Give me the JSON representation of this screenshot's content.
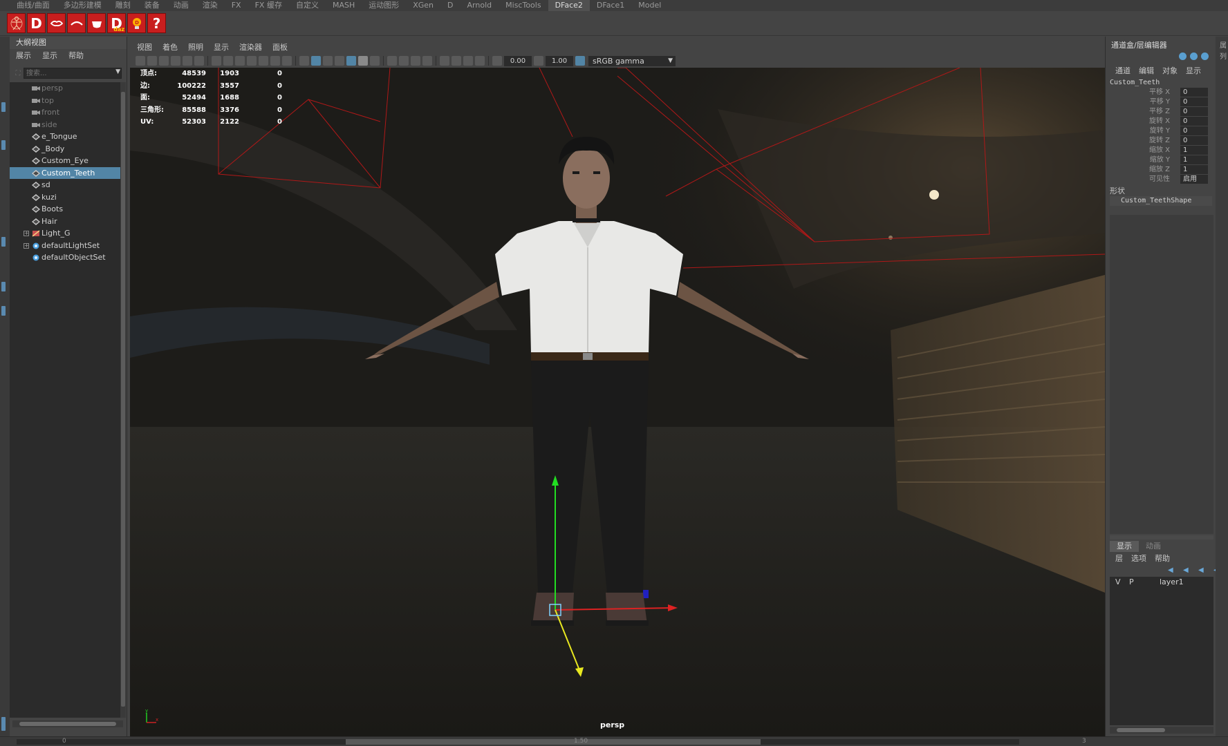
{
  "shelf_tabs": [
    "曲线/曲面",
    "多边形建模",
    "雕刻",
    "装备",
    "动画",
    "渲染",
    "FX",
    "FX 缓存",
    "自定义",
    "MASH",
    "运动图形",
    "XGen",
    "D",
    "Arnold",
    "MiscTools",
    "DFace2",
    "DFace1",
    "Model"
  ],
  "shelf_active": "DFace2",
  "shelf_icons": [
    "figure-icon",
    "d-icon",
    "lips-icon",
    "brow-icon",
    "mouth-icon",
    "daz-d-icon",
    "daz-bulb-icon",
    "help-icon"
  ],
  "shelf_icon_glyphs": {
    "d": "D",
    "daz_d": "D",
    "daz_mark": "daz",
    "help": "?"
  },
  "colors": {
    "accent": "#5285a6",
    "shelf_red": "#c81e1e",
    "panel": "#444444",
    "field": "#2b2b2b"
  },
  "outliner": {
    "title": "大纲视图",
    "menu": [
      "展示",
      "显示",
      "帮助"
    ],
    "search_placeholder": "搜索...",
    "items": [
      {
        "label": "persp",
        "type": "camera",
        "dim": true
      },
      {
        "label": "top",
        "type": "camera",
        "dim": true
      },
      {
        "label": "front",
        "type": "camera",
        "dim": true
      },
      {
        "label": "side",
        "type": "camera",
        "dim": true
      },
      {
        "label": "e_Tongue",
        "type": "mesh"
      },
      {
        "label": "_Body",
        "type": "mesh"
      },
      {
        "label": "Custom_Eye",
        "type": "mesh"
      },
      {
        "label": "Custom_Teeth",
        "type": "mesh",
        "selected": true
      },
      {
        "label": "sd",
        "type": "mesh"
      },
      {
        "label": "kuzi",
        "type": "mesh"
      },
      {
        "label": "Boots",
        "type": "mesh"
      },
      {
        "label": "Hair",
        "type": "mesh"
      },
      {
        "label": "Light_G",
        "type": "light",
        "expand": true
      },
      {
        "label": "defaultLightSet",
        "type": "set",
        "expand": true
      },
      {
        "label": "defaultObjectSet",
        "type": "set"
      }
    ]
  },
  "viewport": {
    "menu": [
      "视图",
      "着色",
      "照明",
      "显示",
      "渲染器",
      "面板"
    ],
    "exposure": "0.00",
    "gamma": "1.00",
    "colorspace": "sRGB gamma",
    "camera": "persp",
    "hud": [
      {
        "label": "顶点:",
        "v1": "48539",
        "v2": "1903",
        "v3": "0"
      },
      {
        "label": "边:",
        "v1": "100222",
        "v2": "3557",
        "v3": "0"
      },
      {
        "label": "面:",
        "v1": "52494",
        "v2": "1688",
        "v3": "0"
      },
      {
        "label": "三角形:",
        "v1": "85588",
        "v2": "3376",
        "v3": "0"
      },
      {
        "label": "UV:",
        "v1": "52303",
        "v2": "2122",
        "v3": "0"
      }
    ],
    "axis_labels": {
      "y": "y",
      "x": "x"
    }
  },
  "channel_box": {
    "title": "通道盒/层编辑器",
    "menu": [
      "通道",
      "编辑",
      "对象",
      "显示"
    ],
    "object": "Custom_Teeth",
    "attributes": [
      {
        "label": "平移 X",
        "value": "0"
      },
      {
        "label": "平移 Y",
        "value": "0"
      },
      {
        "label": "平移 Z",
        "value": "0"
      },
      {
        "label": "旋转 X",
        "value": "0"
      },
      {
        "label": "旋转 Y",
        "value": "0"
      },
      {
        "label": "旋转 Z",
        "value": "0"
      },
      {
        "label": "缩放 X",
        "value": "1"
      },
      {
        "label": "缩放 Y",
        "value": "1"
      },
      {
        "label": "缩放 Z",
        "value": "1"
      },
      {
        "label": "可见性",
        "value": "启用"
      }
    ],
    "shapes_label": "形状",
    "shape": "Custom_TeethShape"
  },
  "layer_editor": {
    "tabs": [
      "显示",
      "动画"
    ],
    "active_tab": "显示",
    "menu": [
      "层",
      "选项",
      "帮助"
    ],
    "layer": {
      "v": "V",
      "p": "P",
      "name": "layer1"
    }
  },
  "right_strip": [
    "属",
    "列"
  ],
  "timeline": {
    "ticks": [
      "0",
      "1.50",
      "3"
    ]
  }
}
